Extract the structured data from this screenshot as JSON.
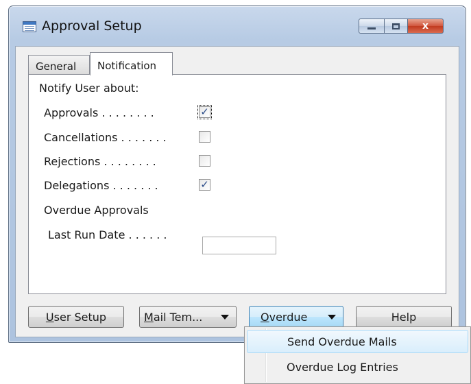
{
  "window": {
    "title": "Approval Setup",
    "close_glyph": "x"
  },
  "tabs": [
    {
      "label": "General",
      "active": false
    },
    {
      "label": "Notification",
      "active": true
    }
  ],
  "notification": {
    "heading": "Notify User about:",
    "fields": [
      {
        "label": "Approvals",
        "dots": ". . . . . . . .",
        "checked": true
      },
      {
        "label": "Cancellations",
        "dots": ". . . . . . .",
        "checked": false
      },
      {
        "label": "Rejections",
        "dots": ". . . . . . . .",
        "checked": false
      },
      {
        "label": "Delegations",
        "dots": ". . . . . . .",
        "checked": true
      }
    ],
    "overdue_heading": "Overdue Approvals",
    "last_run_label": "Last Run Date",
    "last_run_dots": ". . . . . .",
    "last_run_value": ""
  },
  "buttons": {
    "user_setup_u": "U",
    "user_setup_rest": "ser Setup",
    "mail_templates_u": "M",
    "mail_templates_rest": "ail Tem...",
    "overdue_u": "O",
    "overdue_rest": "verdue",
    "help": "Help"
  },
  "overdue_menu": {
    "items": [
      "Send Overdue Mails",
      "Overdue Log Entries"
    ],
    "selected_index": 0
  },
  "colors": {
    "title_bar": "#b7cbe4",
    "close_button": "#c13a1f",
    "checkmark": "#2c4d8a",
    "selected_menu": "#d9eefc"
  },
  "icons": [
    "window-app-icon",
    "minimize-icon",
    "maximize-icon",
    "close-icon",
    "checkmark-icon",
    "dropdown-caret-icon"
  ]
}
